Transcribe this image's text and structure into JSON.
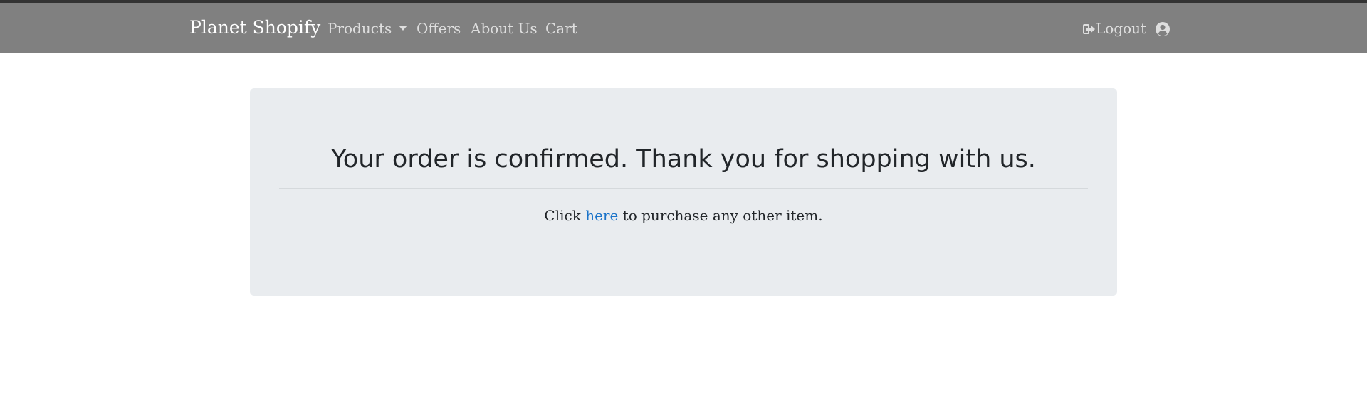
{
  "nav": {
    "brand": "Planet Shopify",
    "products": "Products",
    "offers": "Offers",
    "about": "About Us",
    "cart": "Cart",
    "logout": "Logout",
    "logout_icon": "sign-out-icon",
    "user_icon": "user-circle-icon"
  },
  "confirmation": {
    "title": "Your order is confirmed. Thank you for shopping with us.",
    "text_before": "Click ",
    "link_text": "here",
    "text_after": " to purchase any other item."
  },
  "colors": {
    "navbar": "#808080",
    "panel": "#e9ecef",
    "link": "#1a73c9"
  }
}
